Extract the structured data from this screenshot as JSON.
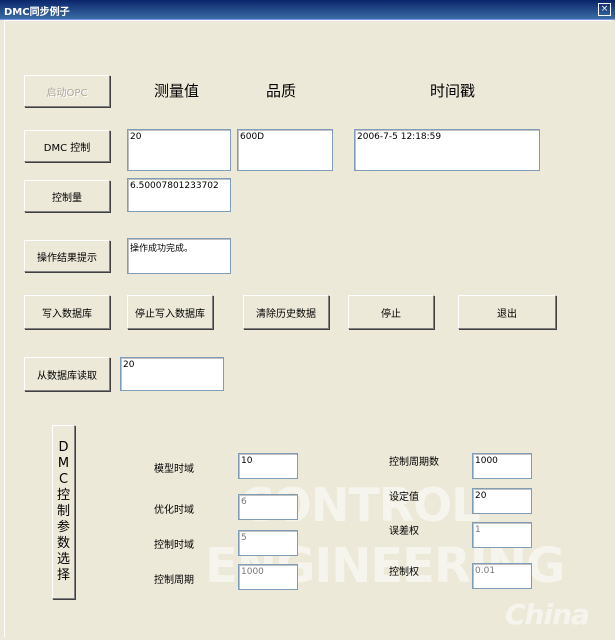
{
  "window": {
    "title": "DMC同步例子",
    "close_glyph": "×"
  },
  "buttons": {
    "start_opc": "启动OPC",
    "dmc_control": "DMC 控制",
    "control_value": "控制量",
    "op_result": "操作结果提示",
    "write_db": "写入数据库",
    "stop_write_db": "停止写入数据库",
    "clear_history": "清除历史数据",
    "stop": "停止",
    "exit": "退出",
    "read_db": "从数据库读取"
  },
  "headers": {
    "measured": "测量值",
    "quality": "品质",
    "timestamp": "时间戳"
  },
  "fields": {
    "measured_value": "20",
    "quality_value": "600D",
    "timestamp_value": "2006-7-5 12:18:59",
    "control_amount": "6.50007801233702",
    "result_text": "操作成功完成。",
    "db_read_value": "20"
  },
  "dmc_param_button": [
    "D",
    "M",
    "C",
    "控",
    "制",
    "参",
    "数",
    "选",
    "择"
  ],
  "params_left": [
    {
      "label": "模型时域",
      "value": "10"
    },
    {
      "label": "优化时域",
      "value": "6"
    },
    {
      "label": "控制时域",
      "value": "5"
    },
    {
      "label": "控制周期",
      "value": "1000"
    }
  ],
  "params_right": [
    {
      "label": "控制周期数",
      "value": "1000"
    },
    {
      "label": "设定值",
      "value": "20"
    },
    {
      "label": "误差权",
      "value": "1"
    },
    {
      "label": "控制权",
      "value": "0.01"
    }
  ],
  "watermark": {
    "line1": "CONTROL",
    "line2": "ENGINEERING",
    "line3": "China"
  }
}
